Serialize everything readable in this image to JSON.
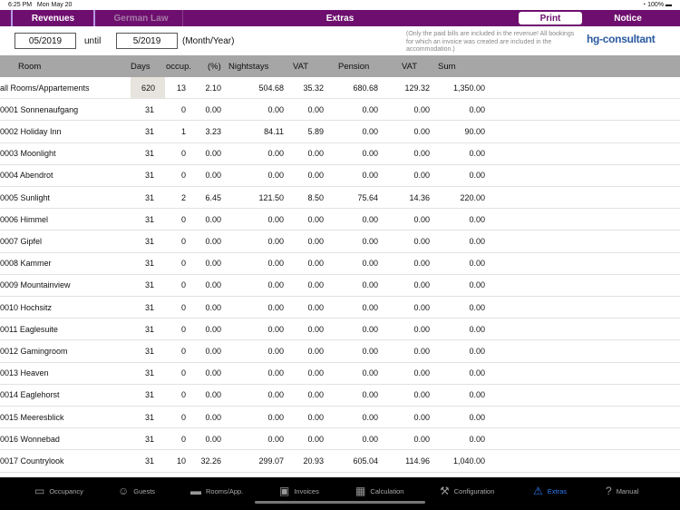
{
  "status": {
    "time": "6:25 PM",
    "date": "Mon May 20",
    "battery": "100%"
  },
  "tabs": {
    "revenues": "Revenues",
    "german_law": "German Law",
    "extras": "Extras",
    "print": "Print",
    "notice": "Notice"
  },
  "filter": {
    "from": "05/2019",
    "until_label": "until",
    "to": "5/2019",
    "format": "(Month/Year)"
  },
  "note": "(Only the paid bills are included in the revenue! All bookings for which an invoice was created are included in the accommodation.)",
  "logo": "hg-consultant",
  "columns": [
    "Room",
    "Days",
    "occup.",
    "(%)",
    "Nightstays",
    "VAT",
    "Pension",
    "VAT",
    "Sum"
  ],
  "rows": [
    [
      "all Rooms/Appartements",
      "620",
      "13",
      "2.10",
      "504.68",
      "35.32",
      "680.68",
      "129.32",
      "1,350.00"
    ],
    [
      "0001 Sonnenaufgang",
      "31",
      "0",
      "0.00",
      "0.00",
      "0.00",
      "0.00",
      "0.00",
      "0.00"
    ],
    [
      "0002 Holiday Inn",
      "31",
      "1",
      "3.23",
      "84.11",
      "5.89",
      "0.00",
      "0.00",
      "90.00"
    ],
    [
      "0003 Moonlight",
      "31",
      "0",
      "0.00",
      "0.00",
      "0.00",
      "0.00",
      "0.00",
      "0.00"
    ],
    [
      "0004 Abendrot",
      "31",
      "0",
      "0.00",
      "0.00",
      "0.00",
      "0.00",
      "0.00",
      "0.00"
    ],
    [
      "0005 Sunlight",
      "31",
      "2",
      "6.45",
      "121.50",
      "8.50",
      "75.64",
      "14.36",
      "220.00"
    ],
    [
      "0006 Himmel",
      "31",
      "0",
      "0.00",
      "0.00",
      "0.00",
      "0.00",
      "0.00",
      "0.00"
    ],
    [
      "0007 Gipfel",
      "31",
      "0",
      "0.00",
      "0.00",
      "0.00",
      "0.00",
      "0.00",
      "0.00"
    ],
    [
      "0008 Kammer",
      "31",
      "0",
      "0.00",
      "0.00",
      "0.00",
      "0.00",
      "0.00",
      "0.00"
    ],
    [
      "0009 Mountainview",
      "31",
      "0",
      "0.00",
      "0.00",
      "0.00",
      "0.00",
      "0.00",
      "0.00"
    ],
    [
      "0010 Hochsitz",
      "31",
      "0",
      "0.00",
      "0.00",
      "0.00",
      "0.00",
      "0.00",
      "0.00"
    ],
    [
      "0011 Eaglesuite",
      "31",
      "0",
      "0.00",
      "0.00",
      "0.00",
      "0.00",
      "0.00",
      "0.00"
    ],
    [
      "0012 Gamingroom",
      "31",
      "0",
      "0.00",
      "0.00",
      "0.00",
      "0.00",
      "0.00",
      "0.00"
    ],
    [
      "0013 Heaven",
      "31",
      "0",
      "0.00",
      "0.00",
      "0.00",
      "0.00",
      "0.00",
      "0.00"
    ],
    [
      "0014 Eaglehorst",
      "31",
      "0",
      "0.00",
      "0.00",
      "0.00",
      "0.00",
      "0.00",
      "0.00"
    ],
    [
      "0015 Meeresblick",
      "31",
      "0",
      "0.00",
      "0.00",
      "0.00",
      "0.00",
      "0.00",
      "0.00"
    ],
    [
      "0016 Wonnebad",
      "31",
      "0",
      "0.00",
      "0.00",
      "0.00",
      "0.00",
      "0.00",
      "0.00"
    ],
    [
      "0017 Countrylook",
      "31",
      "10",
      "32.26",
      "299.07",
      "20.93",
      "605.04",
      "114.96",
      "1,040.00"
    ]
  ],
  "bottom_tabs": [
    {
      "label": "Occupancy",
      "icon": "tablet-icon",
      "glyph": "▭"
    },
    {
      "label": "Guests",
      "icon": "guest-icon",
      "glyph": "☺"
    },
    {
      "label": "Rooms/App.",
      "icon": "bed-icon",
      "glyph": "▬"
    },
    {
      "label": "Invoices",
      "icon": "invoice-icon",
      "glyph": "▣"
    },
    {
      "label": "Calculation",
      "icon": "calculator-icon",
      "glyph": "▦"
    },
    {
      "label": "Configuration",
      "icon": "hammer-icon",
      "glyph": "⚒"
    },
    {
      "label": "Extras",
      "icon": "warning-icon",
      "glyph": "⚠",
      "active": true
    },
    {
      "label": "Manual",
      "icon": "question-icon",
      "glyph": "?"
    }
  ],
  "colors": {
    "brand": "#6e0f6f",
    "active_tab": "#2f7cf6"
  }
}
